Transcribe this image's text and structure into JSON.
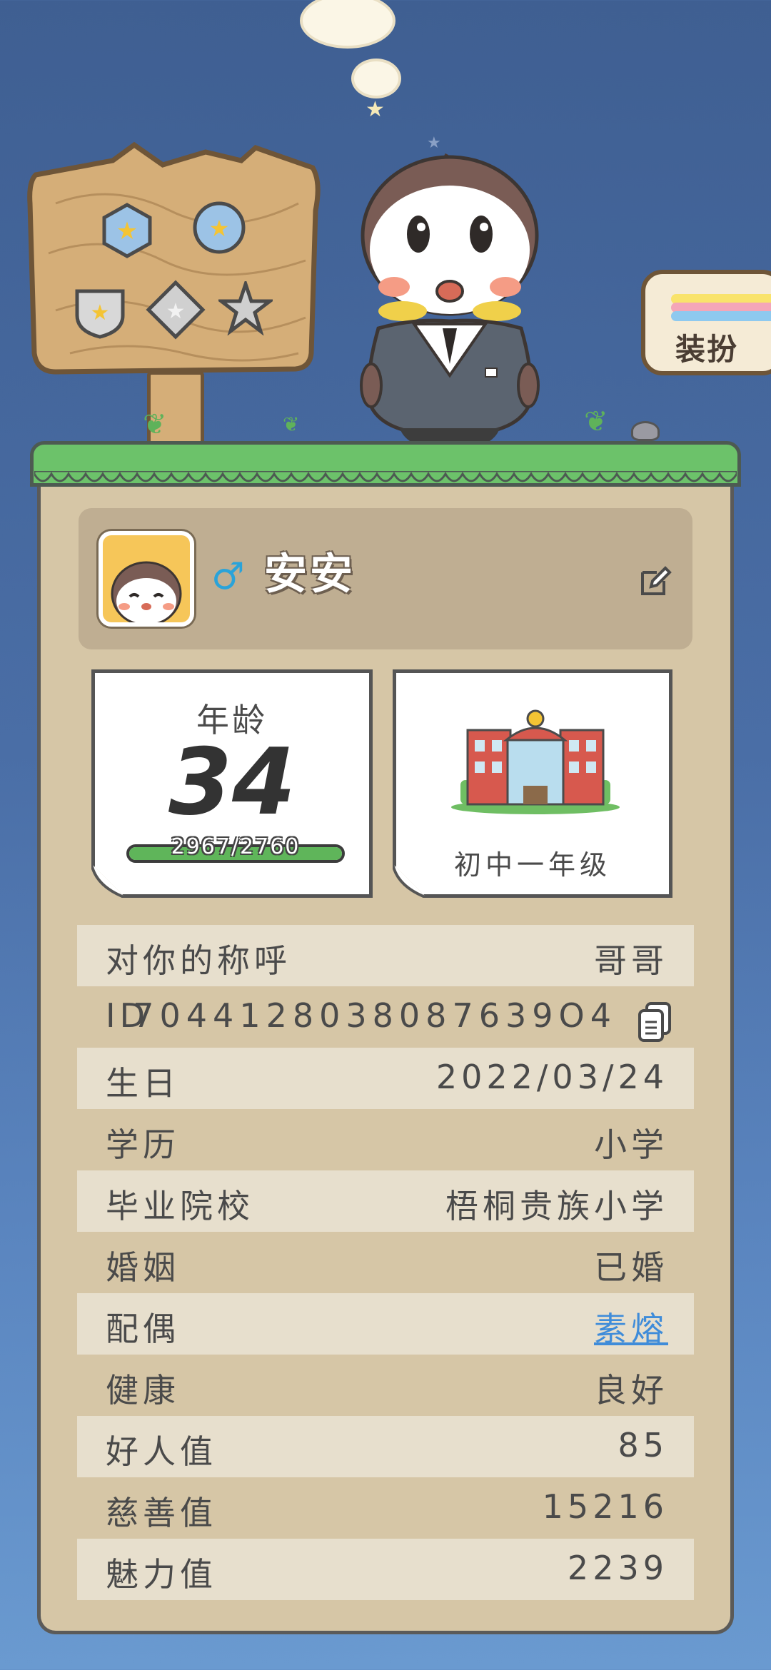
{
  "dressup": {
    "label": "装扮"
  },
  "profile": {
    "gender_symbol": "♂",
    "name": "安安"
  },
  "age": {
    "label": "年龄",
    "value": "34",
    "progress_text": "2967/2760",
    "progress_fraction": 1.0
  },
  "school": {
    "label": "初中一年级"
  },
  "info_rows": [
    {
      "key": "对你的称呼",
      "value": "哥哥"
    },
    {
      "key": "ID",
      "value": "7044128038087639O4"
    },
    {
      "key": "生日",
      "value": "2022/03/24"
    },
    {
      "key": "学历",
      "value": "小学"
    },
    {
      "key": "毕业院校",
      "value": "梧桐贵族小学"
    },
    {
      "key": "婚姻",
      "value": "已婚"
    },
    {
      "key": "配偶",
      "value": "素熔"
    },
    {
      "key": "健康",
      "value": "良好"
    },
    {
      "key": "好人值",
      "value": "85"
    },
    {
      "key": "慈善值",
      "value": "15216"
    },
    {
      "key": "魅力值",
      "value": "2239"
    }
  ],
  "colors": {
    "grass": "#6cc26a",
    "card": "#d6c6a6",
    "link": "#3f8cd9",
    "gender": "#2aa3d9"
  }
}
